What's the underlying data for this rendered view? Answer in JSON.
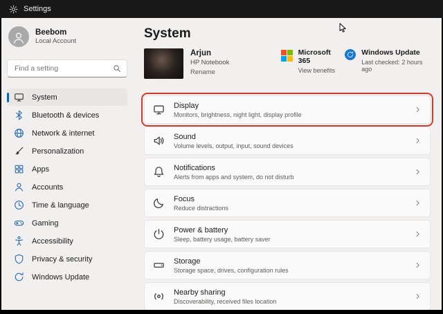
{
  "titlebar": {
    "app_title": "Settings"
  },
  "sidebar": {
    "user": {
      "name": "Beebom",
      "account_type": "Local Account"
    },
    "search_placeholder": "Find a setting",
    "items": [
      {
        "label": "System",
        "icon": "system-icon",
        "selected": true
      },
      {
        "label": "Bluetooth & devices",
        "icon": "bluetooth-icon",
        "selected": false
      },
      {
        "label": "Network & internet",
        "icon": "network-icon",
        "selected": false
      },
      {
        "label": "Personalization",
        "icon": "personalization-icon",
        "selected": false
      },
      {
        "label": "Apps",
        "icon": "apps-icon",
        "selected": false
      },
      {
        "label": "Accounts",
        "icon": "accounts-icon",
        "selected": false
      },
      {
        "label": "Time & language",
        "icon": "time-language-icon",
        "selected": false
      },
      {
        "label": "Gaming",
        "icon": "gaming-icon",
        "selected": false
      },
      {
        "label": "Accessibility",
        "icon": "accessibility-icon",
        "selected": false
      },
      {
        "label": "Privacy & security",
        "icon": "privacy-icon",
        "selected": false
      },
      {
        "label": "Windows Update",
        "icon": "windows-update-icon",
        "selected": false
      }
    ]
  },
  "main": {
    "page_title": "System",
    "device": {
      "name": "Arjun",
      "model": "HP Notebook",
      "rename_label": "Rename"
    },
    "ms365": {
      "title": "Microsoft 365",
      "subtitle": "View benefits"
    },
    "windows_update": {
      "title": "Windows Update",
      "subtitle": "Last checked: 2 hours ago"
    },
    "rows": [
      {
        "title": "Display",
        "subtitle": "Monitors, brightness, night light, display profile",
        "icon": "display-icon",
        "highlighted": true
      },
      {
        "title": "Sound",
        "subtitle": "Volume levels, output, input, sound devices",
        "icon": "sound-icon",
        "highlighted": false
      },
      {
        "title": "Notifications",
        "subtitle": "Alerts from apps and system, do not disturb",
        "icon": "notifications-icon",
        "highlighted": false
      },
      {
        "title": "Focus",
        "subtitle": "Reduce distractions",
        "icon": "focus-icon",
        "highlighted": false
      },
      {
        "title": "Power & battery",
        "subtitle": "Sleep, battery usage, battery saver",
        "icon": "power-icon",
        "highlighted": false
      },
      {
        "title": "Storage",
        "subtitle": "Storage space, drives, configuration rules",
        "icon": "storage-icon",
        "highlighted": false
      },
      {
        "title": "Nearby sharing",
        "subtitle": "Discoverability, received files location",
        "icon": "nearby-sharing-icon",
        "highlighted": false
      }
    ]
  },
  "colors": {
    "accent": "#0067c0",
    "annotation_red": "#d33a2e",
    "ms_logo": [
      "#f25022",
      "#7fba00",
      "#00a4ef",
      "#ffb900"
    ]
  }
}
